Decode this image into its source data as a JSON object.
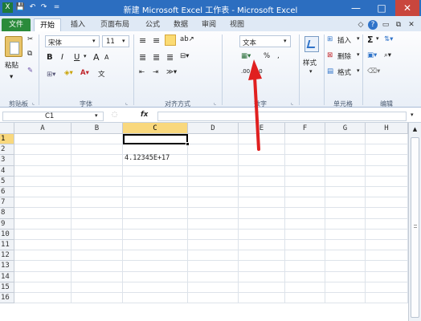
{
  "title": "新建 Microsoft Excel 工作表 - Microsoft Excel",
  "quick_access": {
    "logo": "X",
    "save": "💾",
    "undo": "↶",
    "redo": "↷",
    "more": "="
  },
  "window": {
    "min": "—",
    "max": "□",
    "close": "✕"
  },
  "tabs": [
    {
      "label": "文件"
    },
    {
      "label": "开始"
    },
    {
      "label": "插入"
    },
    {
      "label": "页面布局"
    },
    {
      "label": "公式"
    },
    {
      "label": "数据"
    },
    {
      "label": "审阅"
    },
    {
      "label": "视图"
    }
  ],
  "tab_right_icons": {
    "help": "?",
    "min": "▭",
    "restore": "⧉",
    "close": "✕",
    "caret": "◇"
  },
  "ribbon": {
    "clipboard": {
      "paste": "粘贴",
      "label": "剪贴板"
    },
    "font": {
      "name": "宋体",
      "size": "11",
      "bold": "B",
      "italic": "I",
      "underline": "U",
      "grow": "A",
      "shrink": "A",
      "phonetic": "文",
      "label": "字体"
    },
    "alignment": {
      "label": "对齐方式"
    },
    "number": {
      "format": "文本",
      "percent": "%",
      "comma": ",",
      "inc": ".00",
      "dec": ".0",
      "label": "数字"
    },
    "styles": {
      "label": "样式"
    },
    "cells": {
      "insert": "插入",
      "delete": "删除",
      "format": "格式",
      "label": "单元格"
    },
    "editing": {
      "sum": "Σ",
      "label": "编辑"
    }
  },
  "formula_bar": {
    "name_box": "C1",
    "fx": "fx",
    "value": ""
  },
  "columns": [
    "A",
    "B",
    "C",
    "D",
    "E",
    "F",
    "G",
    "H"
  ],
  "selected_column": "C",
  "rows": [
    "1",
    "2",
    "3",
    "4",
    "5",
    "6",
    "7",
    "8",
    "9",
    "10",
    "11",
    "12",
    "13",
    "14",
    "15",
    "16"
  ],
  "selected_row": "1",
  "cells": {
    "C2": "4.12345E+17"
  },
  "annotation": "red arrow pointing to number format dropdown"
}
